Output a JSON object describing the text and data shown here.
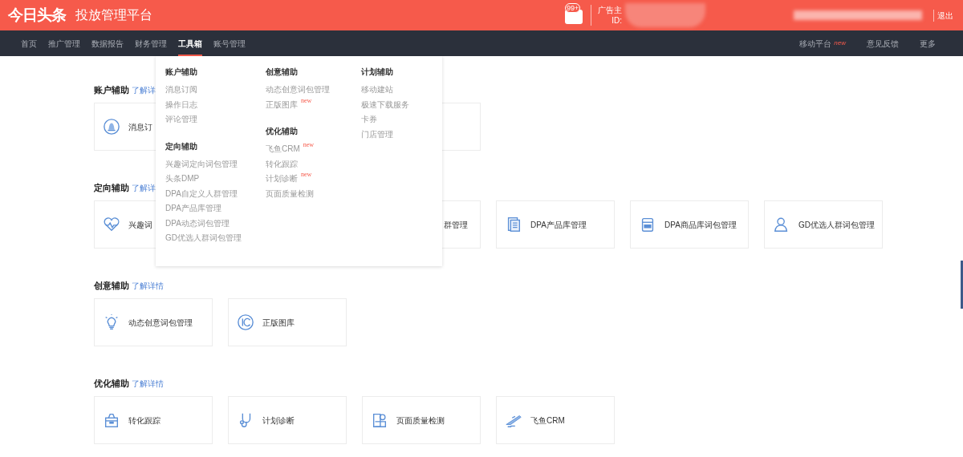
{
  "header": {
    "logo": "今日头条",
    "title": "投放管理平台",
    "message_count": "99+",
    "account_label": "广告主",
    "id_label": "ID:",
    "logout": "退出"
  },
  "nav": {
    "items": [
      {
        "label": "首页",
        "selected": false
      },
      {
        "label": "推广管理",
        "selected": false
      },
      {
        "label": "数据报告",
        "selected": false
      },
      {
        "label": "财务管理",
        "selected": false
      },
      {
        "label": "工具箱",
        "selected": true
      },
      {
        "label": "账号管理",
        "selected": false
      }
    ],
    "right_items": [
      {
        "label": "移动平台",
        "badge": "new"
      },
      {
        "label": "意见反馈"
      },
      {
        "label": "更多"
      }
    ]
  },
  "dropdown": {
    "columns": [
      [
        {
          "title": "账户辅助",
          "items": [
            {
              "label": "消息订阅"
            },
            {
              "label": "操作日志"
            },
            {
              "label": "评论管理"
            }
          ]
        },
        {
          "title": "定向辅助",
          "items": [
            {
              "label": "兴趣词定向词包管理"
            },
            {
              "label": "头条DMP"
            },
            {
              "label": "DPA自定义人群管理"
            },
            {
              "label": "DPA产品库管理"
            },
            {
              "label": "DPA动态词包管理"
            },
            {
              "label": "GD优选人群词包管理"
            }
          ]
        }
      ],
      [
        {
          "title": "创意辅助",
          "items": [
            {
              "label": "动态创意词包管理"
            },
            {
              "label": "正版图库",
              "badge": "new"
            }
          ]
        },
        {
          "title": "优化辅助",
          "items": [
            {
              "label": "飞鱼CRM",
              "badge": "new"
            },
            {
              "label": "转化跟踪"
            },
            {
              "label": "计划诊断",
              "badge": "new"
            },
            {
              "label": "页面质量检测"
            }
          ]
        }
      ],
      [
        {
          "title": "计划辅助",
          "items": [
            {
              "label": "移动建站"
            },
            {
              "label": "极速下载服务"
            },
            {
              "label": "卡券"
            },
            {
              "label": "门店管理"
            }
          ]
        }
      ]
    ]
  },
  "sections": [
    {
      "title": "账户辅助",
      "link": "了解详",
      "cards": [
        {
          "kind": "full",
          "label": "消息订"
        },
        {
          "kind": "partial"
        }
      ]
    },
    {
      "title": "定向辅助",
      "link": "了解详",
      "cards": [
        {
          "kind": "full",
          "label": "兴趣词"
        },
        {
          "kind": "partial",
          "label": "群管理"
        },
        {
          "kind": "full",
          "label": "DPA产品库管理"
        },
        {
          "kind": "full",
          "label": "DPA商品库词包管理"
        },
        {
          "kind": "full",
          "label": "GD优选人群词包管理"
        }
      ]
    },
    {
      "title": "创意辅助",
      "link": "了解详情",
      "cards": [
        {
          "kind": "full",
          "label": "动态创意词包管理"
        },
        {
          "kind": "full",
          "label": "正版图库"
        }
      ]
    },
    {
      "title": "优化辅助",
      "link": "了解详情",
      "cards": [
        {
          "kind": "full",
          "label": "转化跟踪"
        },
        {
          "kind": "full",
          "label": "计划诊断"
        },
        {
          "kind": "full",
          "label": "页面质量检测"
        },
        {
          "kind": "full",
          "label": "飞鱼CRM"
        }
      ]
    }
  ]
}
